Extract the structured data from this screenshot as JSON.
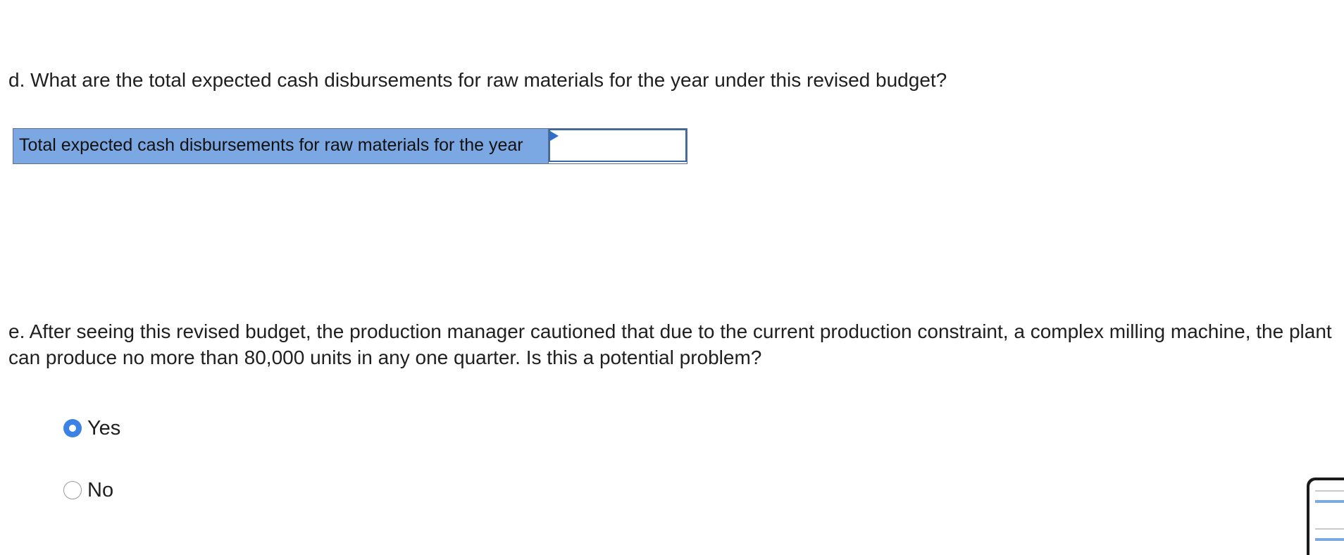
{
  "question_d": {
    "text": "d. What are the total expected cash disbursements for raw materials for the year under this revised budget?"
  },
  "answer_table": {
    "label": "Total expected cash disbursements for raw materials for the year",
    "value": ""
  },
  "question_e": {
    "text": "e. After seeing this revised budget, the production manager cautioned that due to the current production constraint, a complex milling machine, the plant can produce no more than 80,000 units in any one quarter. Is this a potential problem?"
  },
  "options": [
    {
      "label": "Yes",
      "selected": true
    },
    {
      "label": "No",
      "selected": false
    }
  ],
  "colors": {
    "label_bg": "#7ba7e2",
    "radio_selected": "#3b82e6",
    "input_border": "#3a68a8"
  }
}
